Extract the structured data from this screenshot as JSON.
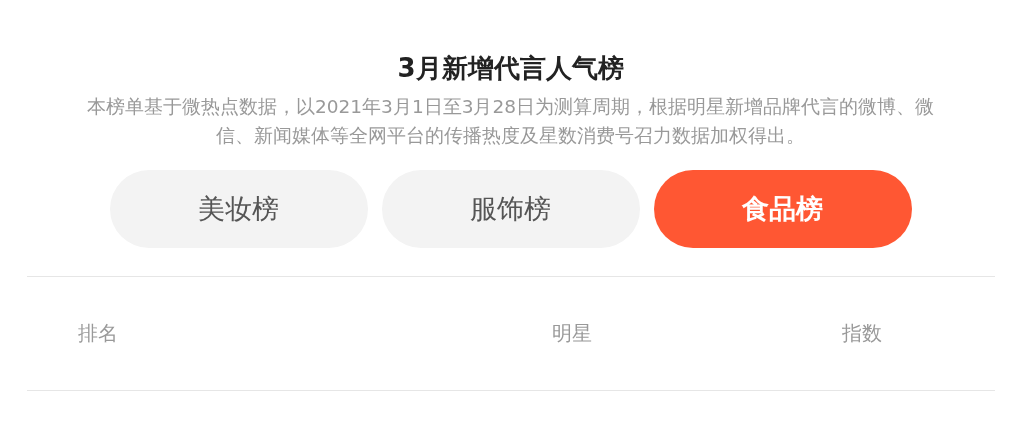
{
  "title": "3月新增代言人气榜",
  "description": "本榜单基于微热点数据，以2021年3月1日至3月28日为测算周期，根据明星新增品牌代言的微博、微信、新闻媒体等全网平台的传播热度及星数消费号召力数据加权得出。",
  "tabs": [
    {
      "label": "美妆榜",
      "selected": false
    },
    {
      "label": "服饰榜",
      "selected": false
    },
    {
      "label": "食品榜",
      "selected": true
    }
  ],
  "table": {
    "columns": [
      "排名",
      "明星",
      "指数"
    ]
  }
}
